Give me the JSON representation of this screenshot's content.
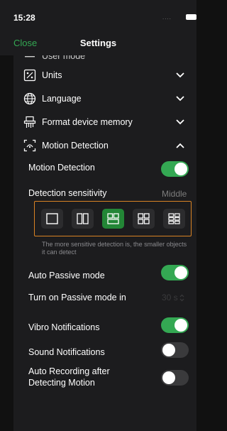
{
  "status": {
    "time": "15:28",
    "signal": "....",
    "battery_icon": "battery-icon"
  },
  "nav": {
    "close": "Close",
    "title": "Settings"
  },
  "menu": {
    "cut_item": "User mode",
    "units": "Units",
    "language": "Language",
    "format_memory": "Format device memory",
    "motion_detection": "Motion Detection"
  },
  "motion": {
    "toggle_label": "Motion Detection",
    "toggle_on": true,
    "sensitivity_label": "Detection sensitivity",
    "sensitivity_value": "Middle",
    "levels": [
      "1",
      "2",
      "3",
      "4",
      "5"
    ],
    "selected_level": 3,
    "hint": "The more sensitive detection is, the smaller objects it can detect"
  },
  "options": {
    "auto_passive": "Auto Passive mode",
    "auto_passive_on": true,
    "passive_in": "Turn on Passive mode in",
    "passive_in_value": "30 s",
    "vibro": "Vibro Notifications",
    "vibro_on": true,
    "sound": "Sound Notifications",
    "sound_on": false,
    "auto_rec_line1": "Auto Recording after",
    "auto_rec_line2": "Detecting Motion",
    "auto_rec_on": false
  },
  "colors": {
    "accent": "#34a853",
    "highlight": "#d98324",
    "selected": "#238636"
  }
}
